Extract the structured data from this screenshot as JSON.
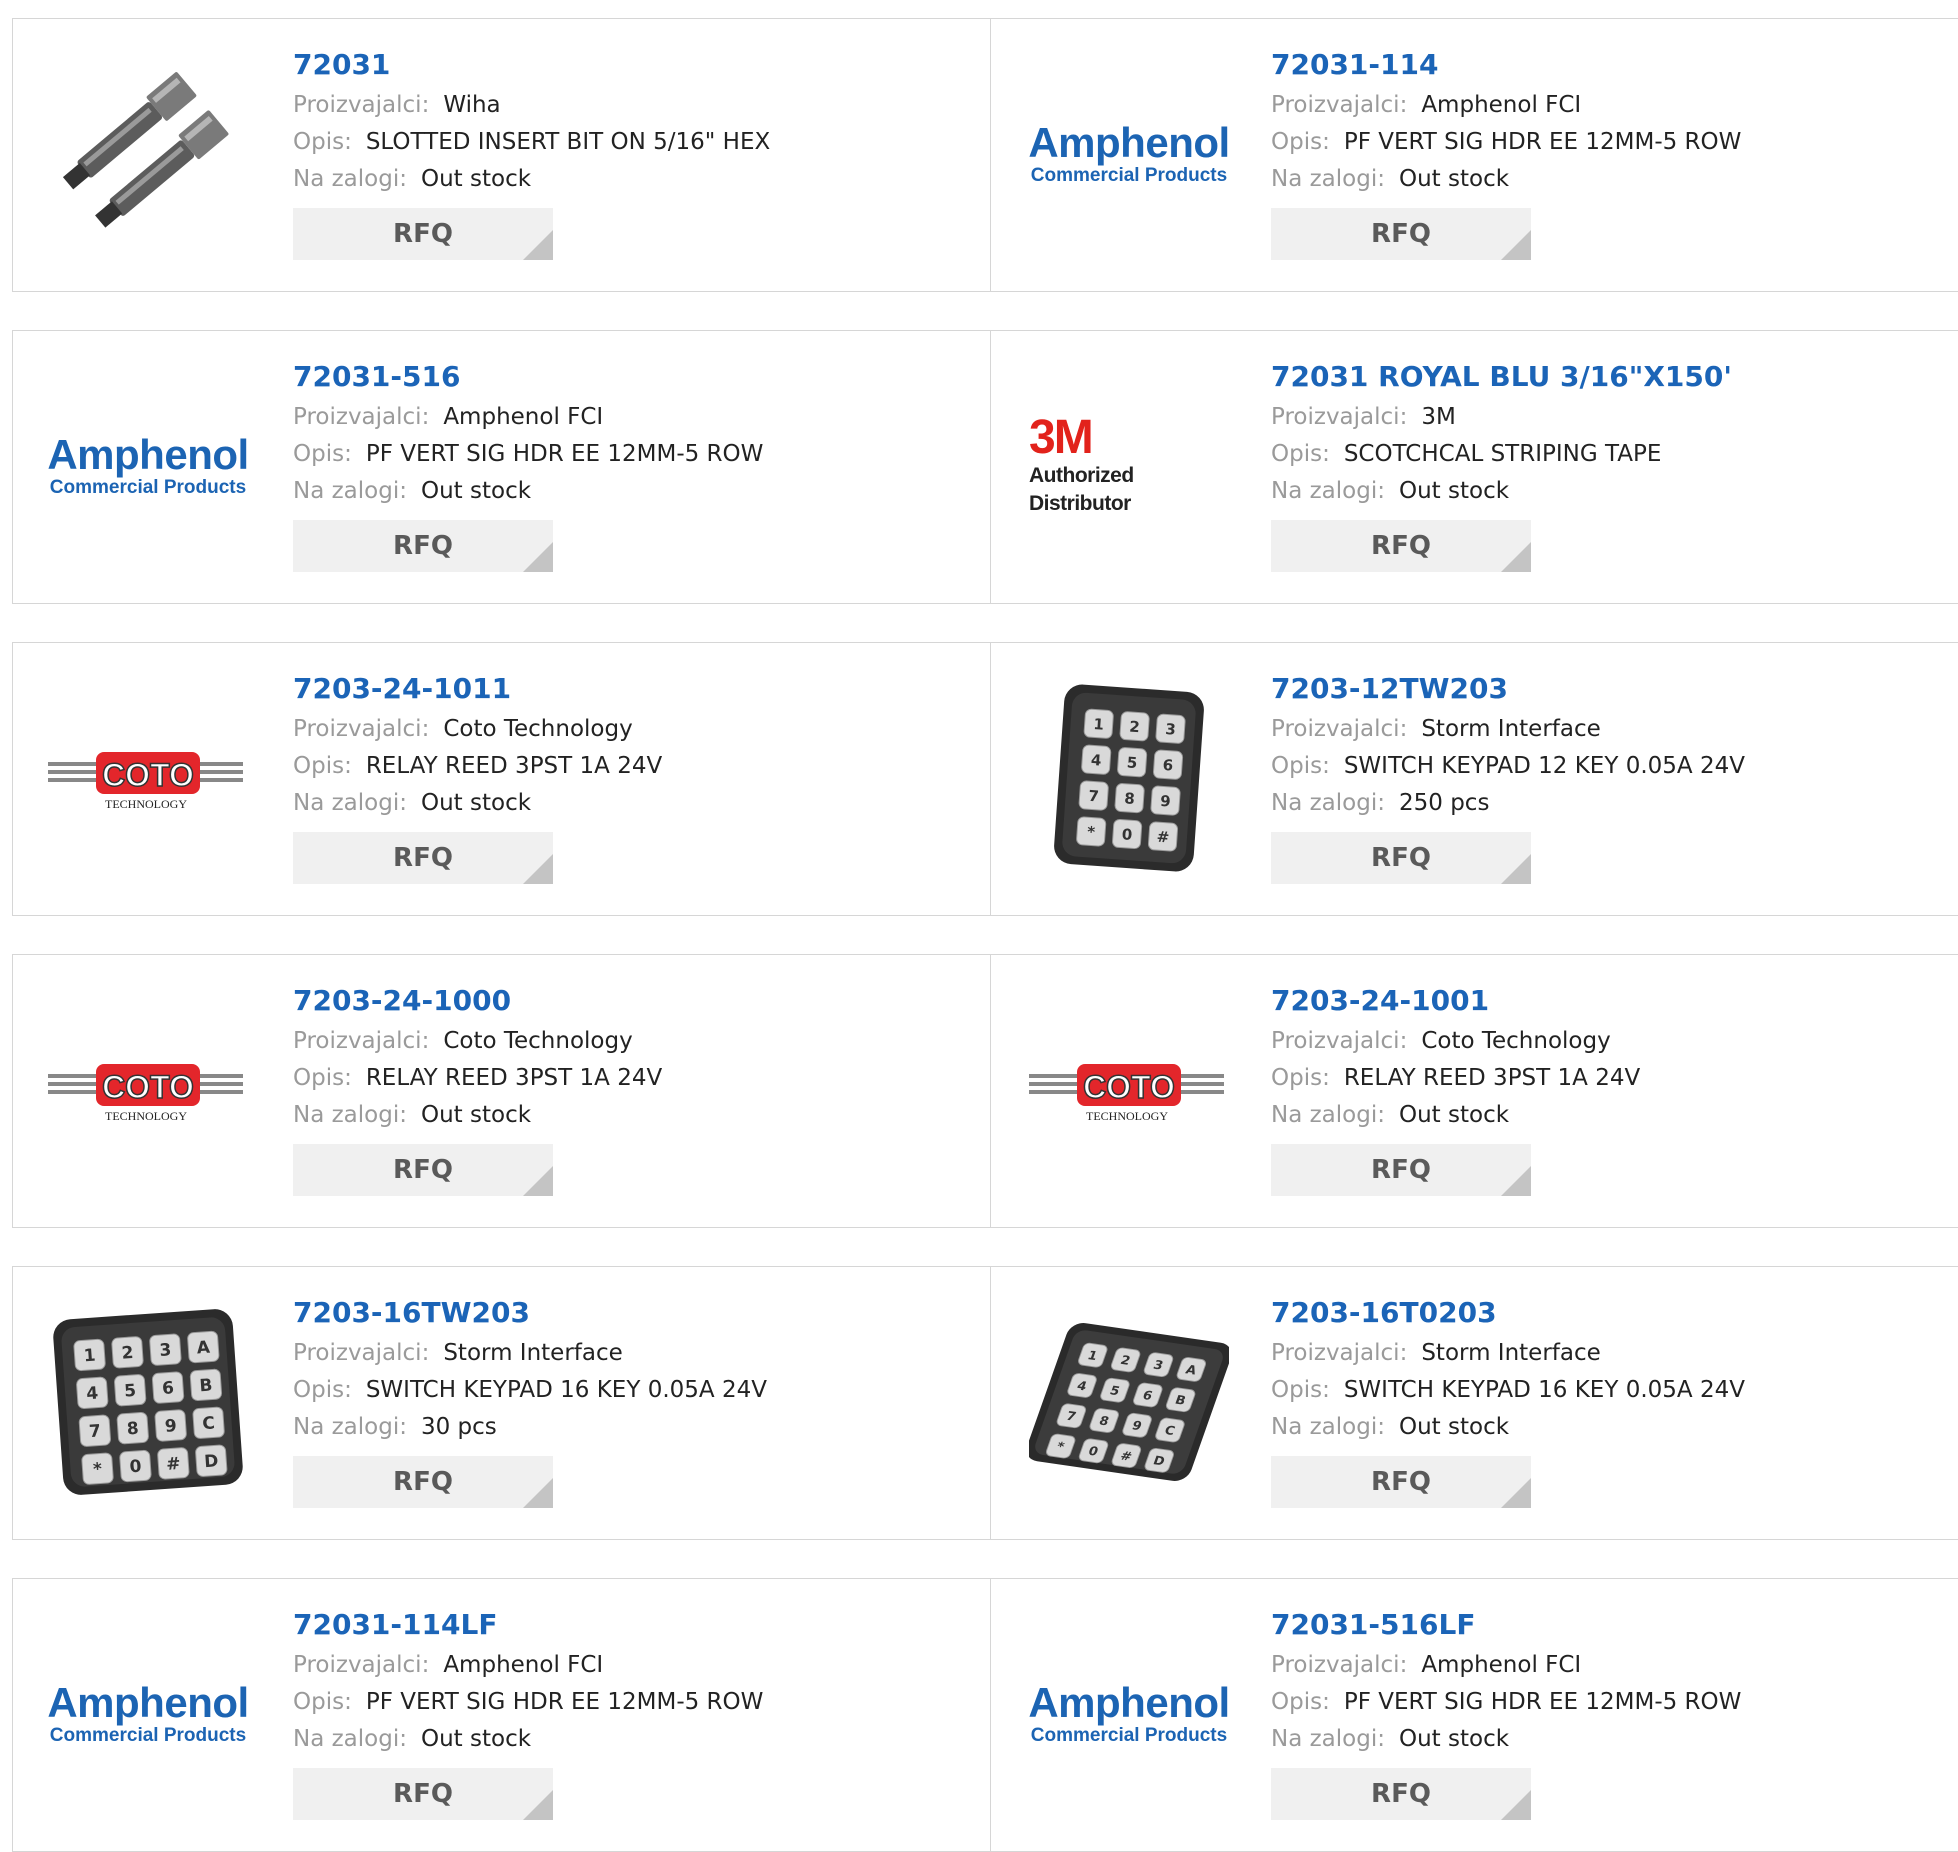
{
  "labels": {
    "manufacturer": "Proizvajalci:",
    "description": "Opis:",
    "stock": "Na zalogi:",
    "rfq": "RFQ"
  },
  "products": [
    {
      "part": "72031",
      "manufacturer": "Wiha",
      "description": "SLOTTED INSERT BIT ON 5/16\" HEX",
      "stock": "Out stock",
      "image": "screwdriver-bit"
    },
    {
      "part": "72031-114",
      "manufacturer": "Amphenol FCI",
      "description": "PF VERT SIG HDR EE 12MM-5 ROW",
      "stock": "Out stock",
      "image": "amphenol-logo"
    },
    {
      "part": "72031-516",
      "manufacturer": "Amphenol FCI",
      "description": "PF VERT SIG HDR EE 12MM-5 ROW",
      "stock": "Out stock",
      "image": "amphenol-logo"
    },
    {
      "part": "72031 ROYAL BLU 3/16\"X150'",
      "manufacturer": "3M",
      "description": "SCOTCHCAL STRIPING TAPE",
      "stock": "Out stock",
      "image": "3m-logo"
    },
    {
      "part": "7203-24-1011",
      "manufacturer": "Coto Technology",
      "description": "RELAY REED 3PST 1A 24V",
      "stock": "Out stock",
      "image": "coto-logo"
    },
    {
      "part": "7203-12TW203",
      "manufacturer": "Storm Interface",
      "description": "SWITCH KEYPAD 12 KEY 0.05A 24V",
      "stock": "250 pcs",
      "image": "keypad-12"
    },
    {
      "part": "7203-24-1000",
      "manufacturer": "Coto Technology",
      "description": "RELAY REED 3PST 1A 24V",
      "stock": "Out stock",
      "image": "coto-logo"
    },
    {
      "part": "7203-24-1001",
      "manufacturer": "Coto Technology",
      "description": "RELAY REED 3PST 1A 24V",
      "stock": "Out stock",
      "image": "coto-logo"
    },
    {
      "part": "7203-16TW203",
      "manufacturer": "Storm Interface",
      "description": "SWITCH KEYPAD 16 KEY 0.05A 24V",
      "stock": "30 pcs",
      "image": "keypad-16"
    },
    {
      "part": "7203-16T0203",
      "manufacturer": "Storm Interface",
      "description": "SWITCH KEYPAD 16 KEY 0.05A 24V",
      "stock": "Out stock",
      "image": "keypad-16-angled"
    },
    {
      "part": "72031-114LF",
      "manufacturer": "Amphenol FCI",
      "description": "PF VERT SIG HDR EE 12MM-5 ROW",
      "stock": "Out stock",
      "image": "amphenol-logo"
    },
    {
      "part": "72031-516LF",
      "manufacturer": "Amphenol FCI",
      "description": "PF VERT SIG HDR EE 12MM-5 ROW",
      "stock": "Out stock",
      "image": "amphenol-logo"
    }
  ],
  "logos": {
    "amphenol": {
      "name": "Amphenol",
      "tagline": "Commercial Products"
    },
    "m3": {
      "name": "3M",
      "tagline": "Authorized Distributor"
    },
    "coto": {
      "name": "COTO",
      "tagline": "TECHNOLOGY"
    }
  },
  "keypad_keys": {
    "twelve": [
      "1",
      "2",
      "3",
      "4",
      "5",
      "6",
      "7",
      "8",
      "9",
      "*",
      "0",
      "#"
    ],
    "sixteen": [
      "1",
      "2",
      "3",
      "A",
      "4",
      "5",
      "6",
      "B",
      "7",
      "8",
      "9",
      "C",
      "*",
      "0",
      "#",
      "D"
    ]
  },
  "colors": {
    "part_link": "#1b64b7",
    "label": "#9a9a9a",
    "amphenol_blue": "#1c64b3",
    "m3_red": "#e2221b",
    "coto_red": "#e3262b"
  }
}
